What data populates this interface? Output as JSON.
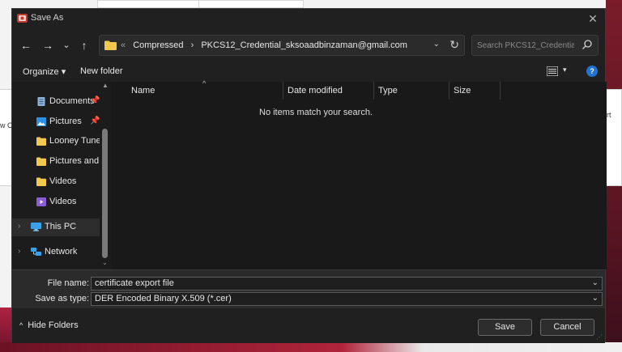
{
  "window": {
    "title": "Save As",
    "close_glyph": "✕"
  },
  "nav_buttons": {
    "back": "←",
    "forward": "→",
    "recent": "⌄",
    "up": "↑"
  },
  "address": {
    "overflow": "«",
    "crumbs": [
      "Compressed",
      "PKCS12_Credential_sksoaadbinzaman@gmail.com"
    ],
    "separator": "›",
    "dropdown": "⌄",
    "refresh": "↻"
  },
  "search": {
    "placeholder": "Search PKCS12_Credential_s..."
  },
  "commands": {
    "organize": "Organize ▾",
    "new_folder": "New folder",
    "view_caret": "▾",
    "help": "?"
  },
  "nav_pane": {
    "items": [
      {
        "label": "Documents",
        "icon": "documents-icon",
        "pinned": true
      },
      {
        "label": "Pictures",
        "icon": "pictures-icon",
        "pinned": true
      },
      {
        "label": "Looney Tunes F",
        "icon": "folder-icon",
        "pinned": false
      },
      {
        "label": "Pictures and ot",
        "icon": "folder-icon",
        "pinned": false
      },
      {
        "label": "Videos",
        "icon": "folder-icon",
        "pinned": false
      },
      {
        "label": "Videos",
        "icon": "videos-icon",
        "pinned": false
      },
      {
        "label": "This PC",
        "icon": "this-pc-icon",
        "pinned": false,
        "selected": true
      },
      {
        "label": "Network",
        "icon": "network-icon",
        "pinned": false
      }
    ],
    "pin_glyph": "📌",
    "expand_glyph": "›"
  },
  "file_list": {
    "columns": [
      "Name",
      "Date modified",
      "Type",
      "Size"
    ],
    "sort_glyph": "^",
    "empty_message": "No items match your search."
  },
  "form": {
    "file_name_label": "File name:",
    "file_name_value": "certificate export file",
    "save_type_label": "Save as type:",
    "save_type_value": "DER Encoded Binary X.509 (*.cer)",
    "caret": "⌄"
  },
  "footer": {
    "hide_folders": "Hide Folders",
    "hide_arrow": "^",
    "save": "Save",
    "cancel": "Cancel"
  },
  "background": {
    "left_fragment": "w C",
    "right_fragment": "rt"
  },
  "colors": {
    "dialog_bg": "#202020",
    "folder_yellow": "#f2c94c",
    "accent_blue": "#1f73d1",
    "wallpaper_maroon": "#7a1c2a"
  }
}
